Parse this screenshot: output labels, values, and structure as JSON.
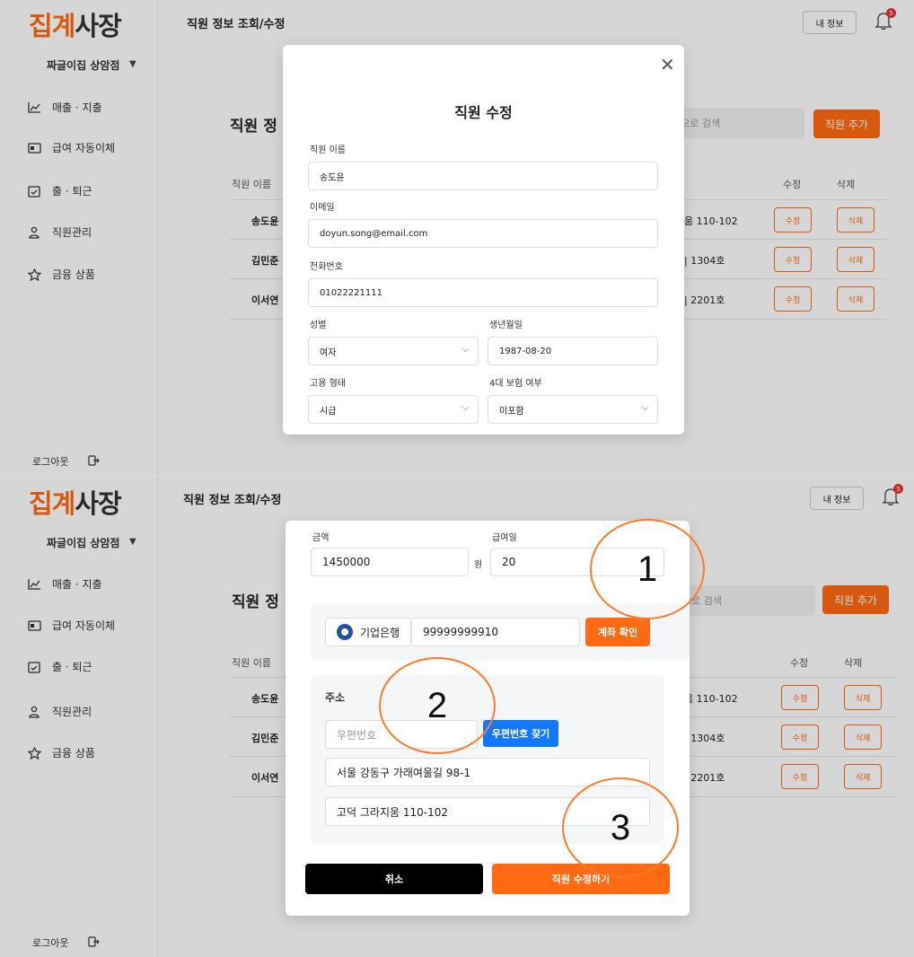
{
  "app": {
    "logo_part1": "집계",
    "logo_part2": "사장",
    "store_name": "짜글이집 상암점",
    "store_arrow": "▼",
    "nav": [
      {
        "label": "매출 · 지출",
        "icon": "chart-line-icon"
      },
      {
        "label": "급여 자동이체",
        "icon": "payment-card-icon"
      },
      {
        "label": "출 · 퇴근",
        "icon": "calendar-check-icon"
      },
      {
        "label": "직원관리",
        "icon": "person-icon"
      },
      {
        "label": "금융 상품",
        "icon": "star-icon"
      }
    ],
    "logout_label": "로그아웃",
    "topbar_title": "직원 정보 조회/수정",
    "my_info_label": "내 정보",
    "notification_count": "5"
  },
  "page": {
    "heading_partial": "직원 정",
    "search_placeholder_partial": "름으로 검색",
    "search_placeholder_partial_bottom": "으로 검색",
    "add_button": "직원 추가",
    "col_name_partial": "직원 이름",
    "col_edit": "수정",
    "col_delete": "삭제",
    "edit_btn": "수정",
    "delete_btn": "삭제",
    "rows": [
      {
        "name_partial": "송도윤",
        "address_partial": "움 110-102"
      },
      {
        "name_partial": "김민준",
        "address_partial": "| 1304호"
      },
      {
        "name_partial": "이서연",
        "address_partial": "| 2201호"
      }
    ]
  },
  "modal_top": {
    "title": "직원 수정",
    "close": "✕",
    "name_label": "직원 이름",
    "name_value": "송도윤",
    "email_label": "이메일",
    "email_value": "doyun.song@email.com",
    "phone_label": "전화번호",
    "phone_value": "01022221111",
    "gender_label": "성별",
    "gender_value": "여자",
    "birth_label": "생년월일",
    "birth_value": "1987-08-20",
    "employment_label": "고용 형태",
    "employment_value": "시급",
    "insurance_label": "4대 보험 여부",
    "insurance_value": "미포함"
  },
  "modal_bottom": {
    "amount_label": "금액",
    "amount_value": "1450000",
    "amount_unit": "원",
    "payday_label": "급여일",
    "payday_value": "20",
    "bank_name": "기업은행",
    "account_number": "99999999910",
    "verify_button": "계좌 확인",
    "address_label": "주소",
    "postcode_placeholder": "우편번호",
    "postcode_button": "우편번호 찾기",
    "address1": "서울 강동구 가래여울길 98-1",
    "address2": "고덕 그라지움 110-102",
    "cancel_button": "취소",
    "submit_button": "직원 수정하기"
  },
  "annotations": [
    "1",
    "2",
    "3"
  ],
  "colors": {
    "accent": "#ff6a13",
    "blue": "#1478ff",
    "annotation": "#ff7b2a"
  }
}
